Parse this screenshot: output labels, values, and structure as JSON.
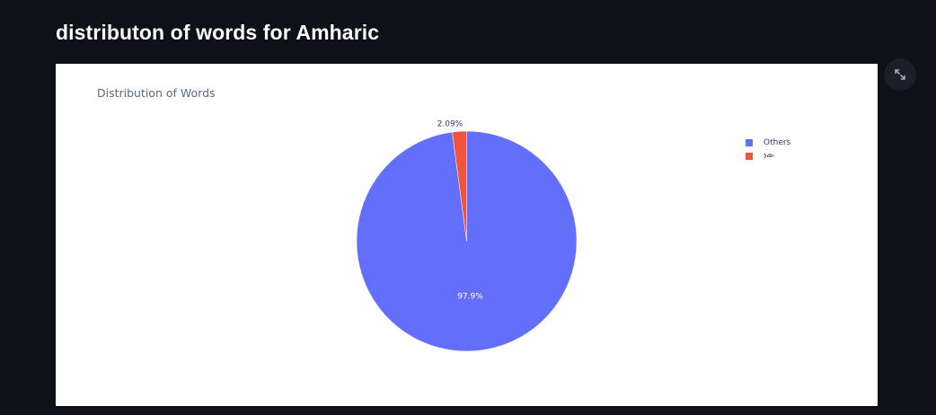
{
  "page": {
    "title": "distributon of words for Amharic"
  },
  "toolbar": {
    "fullscreen_icon": "expand-arrows-icon"
  },
  "chart_data": {
    "type": "pie",
    "title": "Distribution of Words",
    "labels": [
      "Others",
      "ነው"
    ],
    "values": [
      97.91,
      2.09
    ],
    "percent_labels": [
      "97.9%",
      "2.09%"
    ],
    "colors": [
      "#636efa",
      "#ef553b"
    ],
    "legend_position": "top-right"
  }
}
